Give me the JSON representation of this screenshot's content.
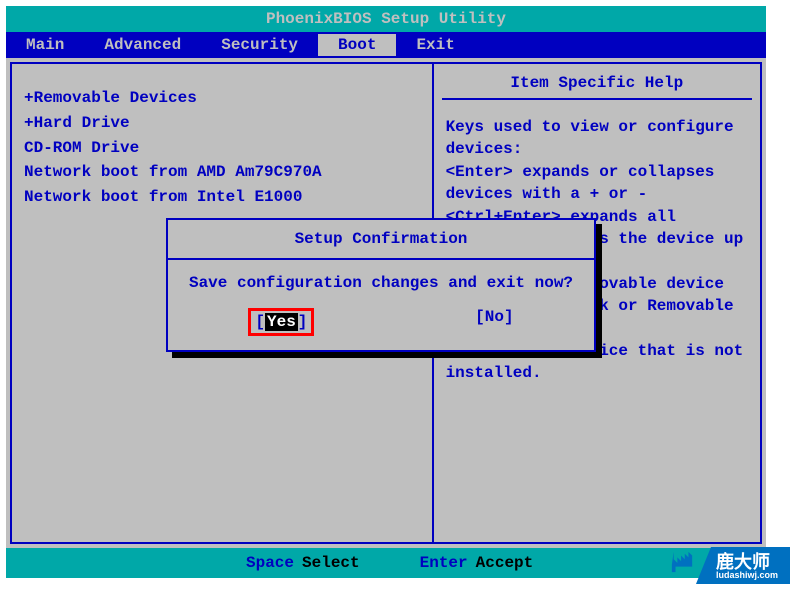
{
  "title": "PhoenixBIOS Setup Utility",
  "menu": {
    "items": [
      "Main",
      "Advanced",
      "Security",
      "Boot",
      "Exit"
    ],
    "activeIndex": 3
  },
  "bootOrder": [
    "+Removable Devices",
    "+Hard Drive",
    " CD-ROM Drive",
    " Network boot from AMD Am79C970A",
    " Network boot from Intel E1000"
  ],
  "helpPanel": {
    "title": "Item Specific Help",
    "text": "Keys used to view or configure devices:\n<Enter> expands or collapses devices with a + or -\n<Ctrl+Enter> expands all\n<+> and <-> moves the device up or down.\n<n> May move removable device between Hard Disk or Removable Disk\n<d> Remove a device that is not installed."
  },
  "dialog": {
    "title": "Setup Confirmation",
    "message": "Save configuration changes and exit now?",
    "buttons": {
      "yes": "Yes",
      "no": "No"
    }
  },
  "footer": {
    "key1": "Space",
    "action1": "Select",
    "key2": "Enter",
    "action2": "Accept"
  },
  "watermark": {
    "brand": "鹿大师",
    "url": "ludashiwj.com"
  }
}
